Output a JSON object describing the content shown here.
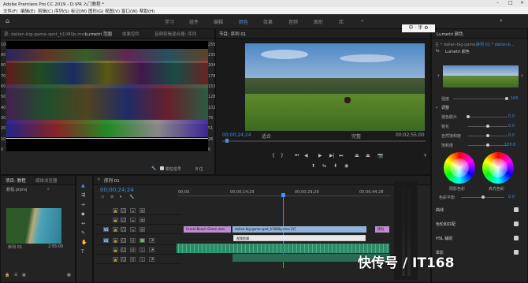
{
  "window": {
    "title": "Adobe Premiere Pro CC 2019 - D:\\PR 入门教程 *"
  },
  "menu": [
    "文件(F)",
    "编辑(E)",
    "剪辑(C)",
    "序列(S)",
    "标记(M)",
    "图形(G)",
    "视图(V)",
    "窗口(W)",
    "帮助(H)"
  ],
  "workspaces": [
    "学习",
    "组件",
    "编辑",
    "颜色",
    "效果",
    "音频",
    "图形",
    "库"
  ],
  "active_workspace": "颜色",
  "scope_panel": {
    "tabs": [
      "源: dalian-big-game-spot_h1080p.mov",
      "Lumetri 范围",
      "效果控件",
      "音频剪辑混合器: 序列",
      "元数据"
    ],
    "active_tab": "Lumetri 范围",
    "left_scale": [
      "100",
      "90",
      "80",
      "70",
      "60",
      "50",
      "40",
      "30",
      "20",
      "10",
      "0"
    ],
    "right_scale": [
      "255",
      "230",
      "204",
      "178",
      "153",
      "128",
      "102",
      "76",
      "51",
      "26",
      "0"
    ],
    "bottom": {
      "clamp_label": "钳位信号",
      "bit_label": "8 位"
    }
  },
  "program_monitor": {
    "tab": "节目: 序列 01",
    "timecode": "00;00;24;24",
    "fit": "适合",
    "quality": "完整",
    "duration": "00;02;55;00"
  },
  "project_panel": {
    "tabs": [
      "项目: 教程",
      "媒体浏览器"
    ],
    "project_file": "教程.prproj",
    "item_name": "序列 01",
    "item_duration": "2:55;00"
  },
  "timeline": {
    "tab": "序列 01",
    "timecode": "00;00;24;24",
    "ruler": [
      "00;00",
      "00;00;14;29",
      "00;00;29;29",
      "00;00;44;28"
    ],
    "video_tracks": [
      "V3",
      "V2",
      "V1"
    ],
    "audio_tracks": [
      "A1",
      "A2",
      "A3"
    ],
    "clips": {
      "v2_clip": "Forest Beach Green.mov",
      "v1_clip": "dalian-big-game-spot_h1080p.mov [V]",
      "v1_tail": "序列",
      "overlay_clip": "视频剪辑"
    }
  },
  "lumetri": {
    "panel_title": "Lumetri 颜色",
    "tabs": [
      "主 * dalian-big-game...",
      "序列 01 * dalian-b..."
    ],
    "preset_name": "Lumetri 颜色",
    "strength_label": "强度",
    "strength_value": "100",
    "adjust_section": "调整",
    "rows": [
      {
        "label": "褪色胶片",
        "value": "0.0"
      },
      {
        "label": "锐化",
        "value": "0.0"
      },
      {
        "label": "自然饱和度",
        "value": "0.0"
      },
      {
        "label": "饱和度",
        "value": "100.0"
      }
    ],
    "wheel_left_label": "阴影色彩",
    "wheel_right_label": "高光色彩",
    "tint_balance_label": "色彩平衡",
    "tint_balance_value": "0.0",
    "sections": [
      "曲线",
      "色轮和匹配",
      "HSL 辅助",
      "晕影"
    ]
  },
  "ime": {
    "text": "中 · 半 ⚙"
  },
  "watermark": {
    "text": "快传号 / IT168"
  },
  "colors": {
    "accent": "#3c8ee0",
    "playhead": "#4a90e2",
    "v2_clip": "#c08ad6",
    "v1_clip": "#8fb3e0",
    "audio_clip": "#2e8b6a"
  }
}
